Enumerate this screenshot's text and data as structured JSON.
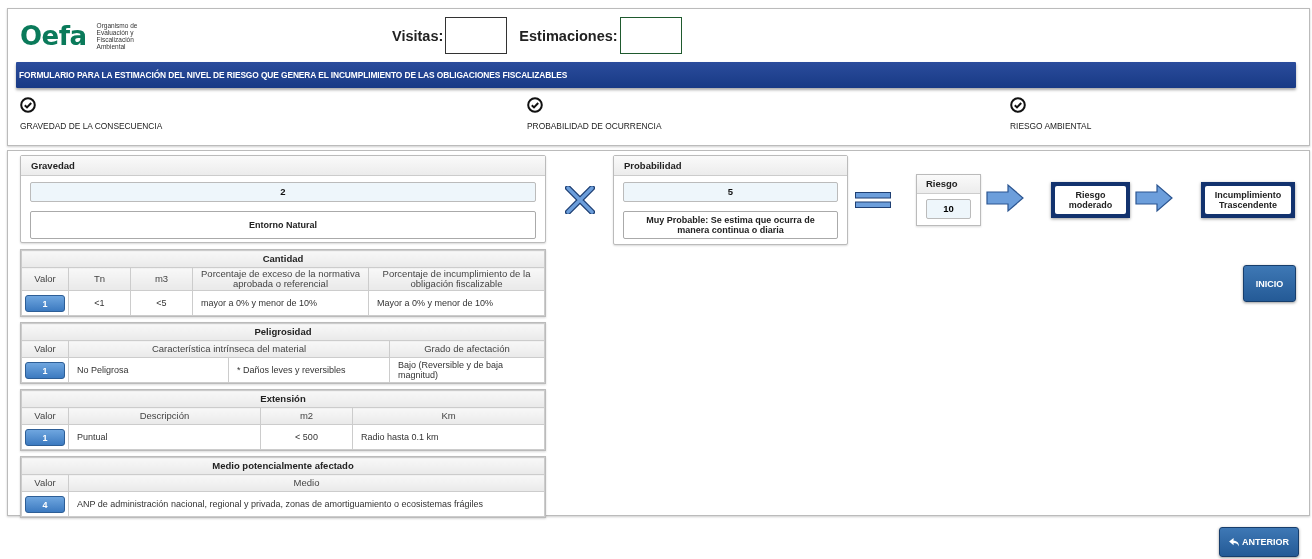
{
  "logo": {
    "name": "Oefa",
    "tagline": "Organismo de Evaluación y Fiscalización Ambiental"
  },
  "counters": [
    {
      "label": "Visitas:"
    },
    {
      "label": "Estimaciones:"
    }
  ],
  "banner": "FORMULARIO PARA LA ESTIMACIÓN DEL NIVEL DE RIESGO QUE GENERA EL INCUMPLIMIENTO DE LAS OBLIGACIONES FISCALIZABLES",
  "steps": [
    {
      "label": "GRAVEDAD DE LA CONSECUENCIA",
      "checked": true
    },
    {
      "label": "PROBABILIDAD DE OCURRENCIA",
      "checked": true
    },
    {
      "label": "RIESGO AMBIENTAL",
      "checked": true
    }
  ],
  "gravedad": {
    "title": "Gravedad",
    "value": "2",
    "description": "Entorno Natural"
  },
  "tables": [
    {
      "title": "Cantidad",
      "columns": [
        "Valor",
        "Tn",
        "m3",
        "Porcentaje de exceso de la normativa aprobada o referencial",
        "Porcentaje de incumplimiento de la obligación fiscalizable"
      ],
      "row": {
        "value": "1",
        "cells": [
          "<1",
          "<5",
          "mayor a 0% y menor de 10%",
          "Mayor a 0% y menor de 10%"
        ]
      }
    },
    {
      "title": "Peligrosidad",
      "columns": [
        "Valor",
        "Característica intrínseca del material",
        "Grado de afectación"
      ],
      "row": {
        "value": "1",
        "cells": [
          "No Peligrosa",
          "* Daños leves y reversibles",
          "Bajo (Reversible y de baja magnitud)"
        ]
      }
    },
    {
      "title": "Extensión",
      "columns": [
        "Valor",
        "Descripción",
        "m2",
        "Km"
      ],
      "row": {
        "value": "1",
        "cells": [
          "Puntual",
          "< 500",
          "Radio hasta 0.1 km"
        ]
      }
    },
    {
      "title": "Medio potencialmente afectado",
      "columns": [
        "Valor",
        "Medio"
      ],
      "row": {
        "value": "4",
        "cells": [
          "ANP de administración nacional, regional y privada, zonas de amortiguamiento o ecosistemas frágiles"
        ]
      }
    }
  ],
  "probabilidad": {
    "title": "Probabilidad",
    "value": "5",
    "description": "Muy Probable: Se estima que ocurra de manera continua o diaria"
  },
  "riesgo": {
    "title": "Riesgo",
    "value": "10"
  },
  "results": [
    "Riesgo moderado",
    "Incumplimiento Trascendente"
  ],
  "buttons": {
    "inicio": "INICIO",
    "anterior": "ANTERIOR"
  }
}
